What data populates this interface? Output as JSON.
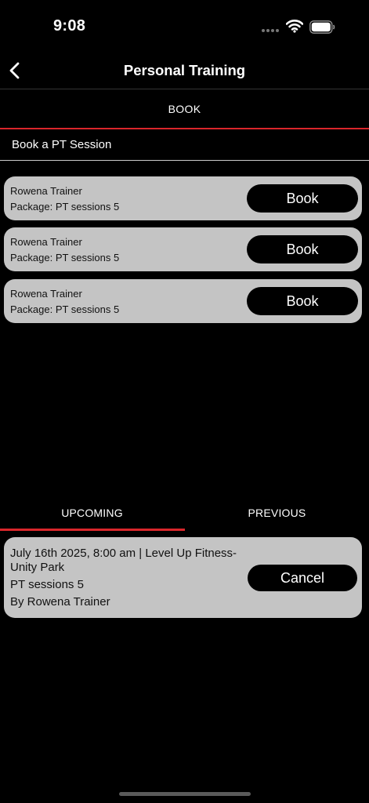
{
  "status_bar": {
    "time": "9:08"
  },
  "nav": {
    "title": "Personal Training"
  },
  "book_tab": {
    "label": "BOOK"
  },
  "section_heading": "Book a PT Session",
  "sessions": [
    {
      "trainer": "Rowena Trainer",
      "package": "Package: PT sessions 5",
      "button": "Book"
    },
    {
      "trainer": "Rowena Trainer",
      "package": "Package: PT sessions 5",
      "button": "Book"
    },
    {
      "trainer": "Rowena Trainer",
      "package": "Package: PT sessions 5",
      "button": "Book"
    }
  ],
  "history_tabs": {
    "upcoming": "UPCOMING",
    "previous": "PREVIOUS",
    "active": "upcoming"
  },
  "upcoming_booking": {
    "when_where": "July 16th 2025, 8:00 am | Level Up Fitness-Unity Park",
    "package": "PT sessions 5",
    "trainer": "By Rowena Trainer",
    "cancel_label": "Cancel"
  },
  "colors": {
    "accent": "#d9262b",
    "card": "#c4c4c4",
    "background": "#000000"
  }
}
